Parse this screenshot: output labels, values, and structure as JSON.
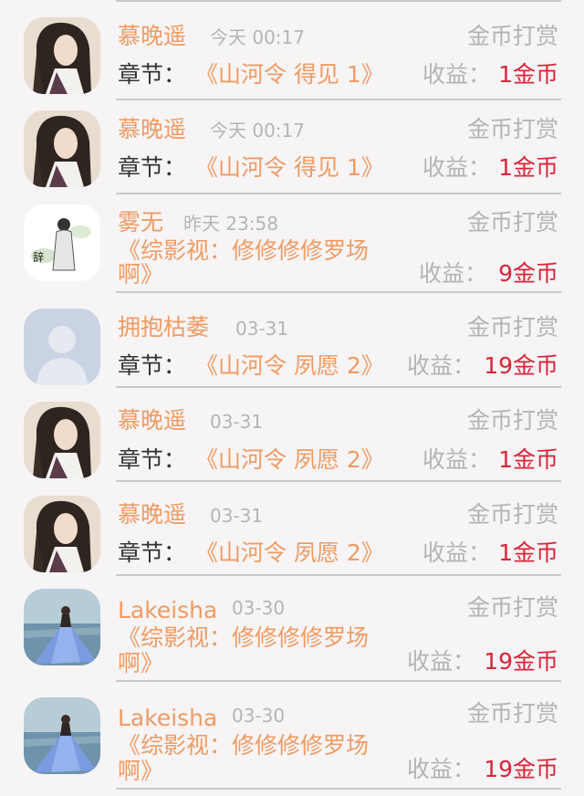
{
  "items": [
    {
      "name": "慕晚遥",
      "time": "今天 00:17",
      "reward": "金币打赏",
      "chapter_label": "章节：",
      "chapter": "《山河令 得见 1》",
      "earn_label": "收益：",
      "earn_value": "1金币",
      "avatar": "ancient-man-avatar"
    },
    {
      "name": "慕晚遥",
      "time": "今天 00:17",
      "reward": "金币打赏",
      "chapter_label": "章节：",
      "chapter": "《山河令 得见 1》",
      "earn_label": "收益：",
      "earn_value": "1金币",
      "avatar": "ancient-man-avatar"
    },
    {
      "name": "雾无",
      "time": "昨天 23:58",
      "reward": "金币打赏",
      "book_line1": "《综影视：修修修修罗场",
      "book_line2": "啊》",
      "earn_label": "收益：",
      "earn_value": "9金币",
      "avatar": "ink-painting-avatar"
    },
    {
      "name": "拥抱枯萎",
      "time": "03-31",
      "reward": "金币打赏",
      "chapter_label": "章节：",
      "chapter": "《山河令 夙愿 2》",
      "earn_label": "收益：",
      "earn_value": "19金币",
      "avatar": "default-user-avatar"
    },
    {
      "name": "慕晚遥",
      "time": "03-31",
      "reward": "金币打赏",
      "chapter_label": "章节：",
      "chapter": "《山河令 夙愿 2》",
      "earn_label": "收益：",
      "earn_value": "1金币",
      "avatar": "ancient-man-avatar"
    },
    {
      "name": "慕晚遥",
      "time": "03-31",
      "reward": "金币打赏",
      "chapter_label": "章节：",
      "chapter": "《山河令 夙愿 2》",
      "earn_label": "收益：",
      "earn_value": "1金币",
      "avatar": "ancient-man-avatar"
    },
    {
      "name": "Lakeisha",
      "time": "03-30",
      "reward": "金币打赏",
      "book_line1": "《综影视：修修修修罗场",
      "book_line2": "啊》",
      "earn_label": "收益：",
      "earn_value": "19金币",
      "avatar": "sea-girl-avatar"
    },
    {
      "name": "Lakeisha",
      "time": "03-30",
      "reward": "金币打赏",
      "book_line1": "《综影视：修修修修罗场",
      "book_line2": "啊》",
      "earn_label": "收益：",
      "earn_value": "19金币",
      "avatar": "sea-girl-avatar"
    }
  ]
}
